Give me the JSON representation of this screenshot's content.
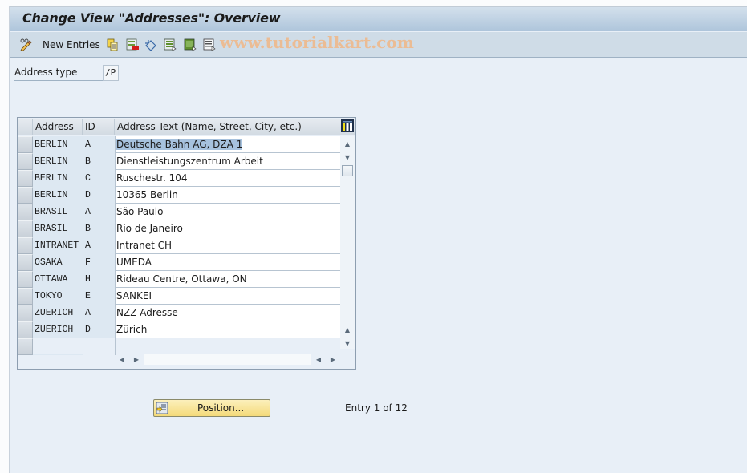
{
  "window": {
    "title": "Change View \"Addresses\": Overview"
  },
  "toolbar": {
    "items": [
      {
        "icon": "change-display-icon",
        "label": ""
      },
      {
        "icon": "new-entries-icon",
        "label": "New Entries"
      },
      {
        "icon": "copy-icon",
        "label": ""
      },
      {
        "icon": "delete-icon",
        "label": ""
      },
      {
        "icon": "undo-change-icon",
        "label": ""
      },
      {
        "icon": "select-all-icon",
        "label": ""
      },
      {
        "icon": "select-block-icon",
        "label": ""
      },
      {
        "icon": "deselect-all-icon",
        "label": ""
      }
    ],
    "watermark": "www.tutorialkart.com"
  },
  "filter": {
    "label": "Address type",
    "value": "/P"
  },
  "table": {
    "columns": [
      "Address",
      "ID",
      "Address Text (Name, Street, City, etc.)"
    ],
    "rows": [
      {
        "address": "BERLIN",
        "id": "A",
        "text": "Deutsche Bahn AG, DZA 1",
        "selected": true
      },
      {
        "address": "BERLIN",
        "id": "B",
        "text": "Dienstleistungszentrum Arbeit"
      },
      {
        "address": "BERLIN",
        "id": "C",
        "text": "Ruschestr. 104"
      },
      {
        "address": "BERLIN",
        "id": "D",
        "text": "10365 Berlin"
      },
      {
        "address": "BRASIL",
        "id": "A",
        "text": "São Paulo"
      },
      {
        "address": "BRASIL",
        "id": "B",
        "text": "Rio de Janeiro"
      },
      {
        "address": "INTRANET",
        "id": "A",
        "text": "Intranet CH"
      },
      {
        "address": "OSAKA",
        "id": "F",
        "text": "UMEDA"
      },
      {
        "address": "OTTAWA",
        "id": "H",
        "text": "Rideau Centre, Ottawa, ON"
      },
      {
        "address": "TOKYO",
        "id": "E",
        "text": "SANKEI"
      },
      {
        "address": "ZUERICH",
        "id": "A",
        "text": "NZZ Adresse"
      },
      {
        "address": "ZUERICH",
        "id": "D",
        "text": "Zürich"
      }
    ]
  },
  "footer": {
    "position_button": "Position...",
    "entry_info": "Entry 1 of 12"
  },
  "colors": {
    "title_bar": "#aec5db",
    "toolbar": "#cfdce7",
    "background": "#e8eff7",
    "selection": "#a7c2de",
    "button": "#f4da7a",
    "watermark": "#efb98c"
  }
}
